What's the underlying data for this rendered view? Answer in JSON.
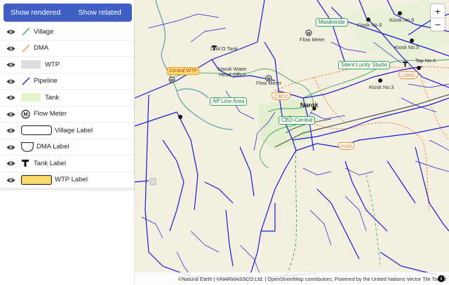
{
  "toolbar": {
    "show_rendered": "Show rendered",
    "show_related": "Show related"
  },
  "legend": {
    "items": [
      {
        "label": "Village"
      },
      {
        "label": "DMA"
      },
      {
        "label": "WTP"
      },
      {
        "label": "Pipeline"
      },
      {
        "label": "Tank"
      },
      {
        "label": "Flow Meter"
      },
      {
        "label": "Village Label"
      },
      {
        "label": "DMA Label"
      },
      {
        "label": "Tank Label"
      },
      {
        "label": "WTP Label"
      }
    ]
  },
  "map": {
    "labels": {
      "central_wtp": "Central WTP",
      "d_w_o_tank": "D.W.O Tank",
      "head_office_1": "Narok Water",
      "head_office_2": "Head Office",
      "flow_meter_1": "Flow Meter",
      "flow_meter_2": "Flow Meter",
      "ap_line_area": "AP Line Area",
      "cbd2": "CBD2",
      "narok": "Narok",
      "cbd_central": "CBD-Central",
      "masikonde": "Masikonde",
      "silent_lucky": "Silent Lucky Studio",
      "kiosk_6a": "Kiosk No.6",
      "kiosk_6b": "Kiosk No.6",
      "kiosk_5": "Kiosk No.5",
      "kiosk_3": "Kiosk No.3",
      "tap_no": "Tap No.6",
      "lond": "LOND",
      "muki": "muki"
    },
    "zoom_in": "+",
    "zoom_out": "−",
    "attribution": "©Natural Earth | ©NARWASSCO,Ltd. | OpenStreetMap contributors, Powered by the United Nations Vector Tile Toolkit",
    "info": "i"
  },
  "colors": {
    "button_bg": "#3f5fc7",
    "village": "#33a852",
    "dma": "#f08c34",
    "pipeline": "#1a1ad6",
    "wtp_fill": "#ffdb6e"
  }
}
